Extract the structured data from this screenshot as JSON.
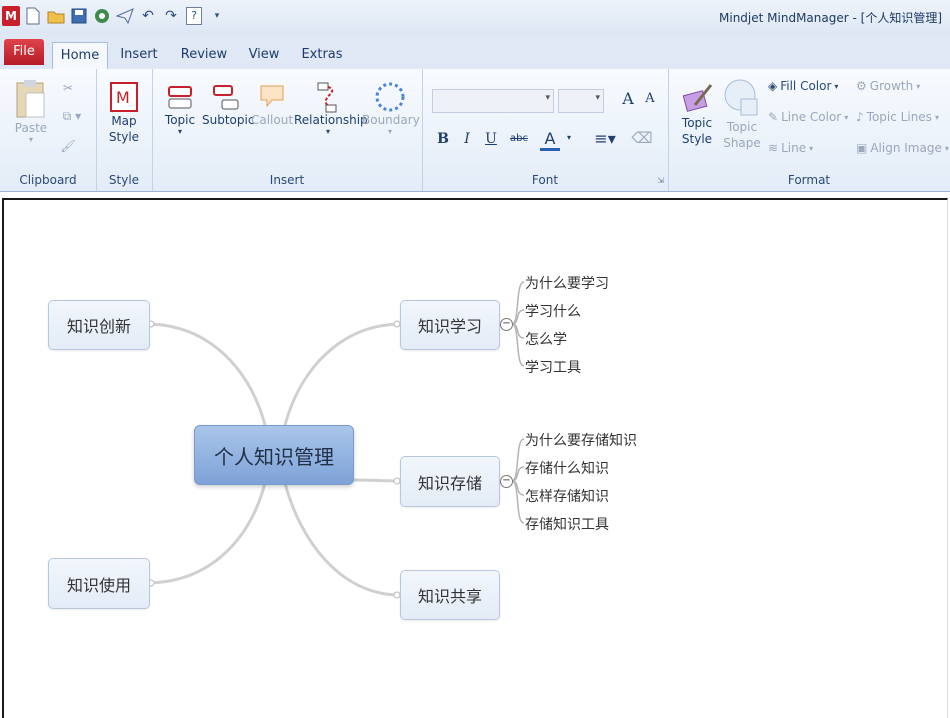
{
  "window": {
    "title": "Mindjet MindManager - [个人知识管理]"
  },
  "qat": {
    "help_label": "?"
  },
  "tabs": [
    {
      "label": "File"
    },
    {
      "label": "Home"
    },
    {
      "label": "Insert"
    },
    {
      "label": "Review"
    },
    {
      "label": "View"
    },
    {
      "label": "Extras"
    }
  ],
  "ribbon": {
    "clipboard": {
      "group": "Clipboard",
      "paste": "Paste"
    },
    "style": {
      "group": "Style",
      "map_style": "Map Style"
    },
    "insert": {
      "group": "Insert",
      "topic": "Topic",
      "subtopic": "Subtopic",
      "callout": "Callout",
      "relationship": "Relationship",
      "boundary": "Boundary"
    },
    "font": {
      "group": "Font",
      "bold": "B",
      "italic": "I",
      "underline": "U",
      "strike": "abc",
      "font_color": "A",
      "grow": "A",
      "shrink": "A"
    },
    "format": {
      "group": "Format",
      "topic_style": "Topic Style",
      "topic_shape": "Topic Shape",
      "fill_color": "Fill Color",
      "line_color": "Line Color",
      "line": "Line",
      "growth": "Growth",
      "topic_lines": "Topic Lines",
      "align_image": "Align Image"
    }
  },
  "map": {
    "central": "个人知识管理",
    "topics": [
      {
        "label": "知识创新"
      },
      {
        "label": "知识使用"
      },
      {
        "label": "知识学习",
        "subtopics": [
          "为什么要学习",
          "学习什么",
          "怎么学",
          "学习工具"
        ]
      },
      {
        "label": "知识存储",
        "subtopics": [
          "为什么要存储知识",
          "存储什么知识",
          "怎样存储知识",
          "存储知识工具"
        ]
      },
      {
        "label": "知识共享"
      }
    ]
  },
  "colors": {
    "accent": "#7ea2d8",
    "file_tab": "#c8202a"
  }
}
